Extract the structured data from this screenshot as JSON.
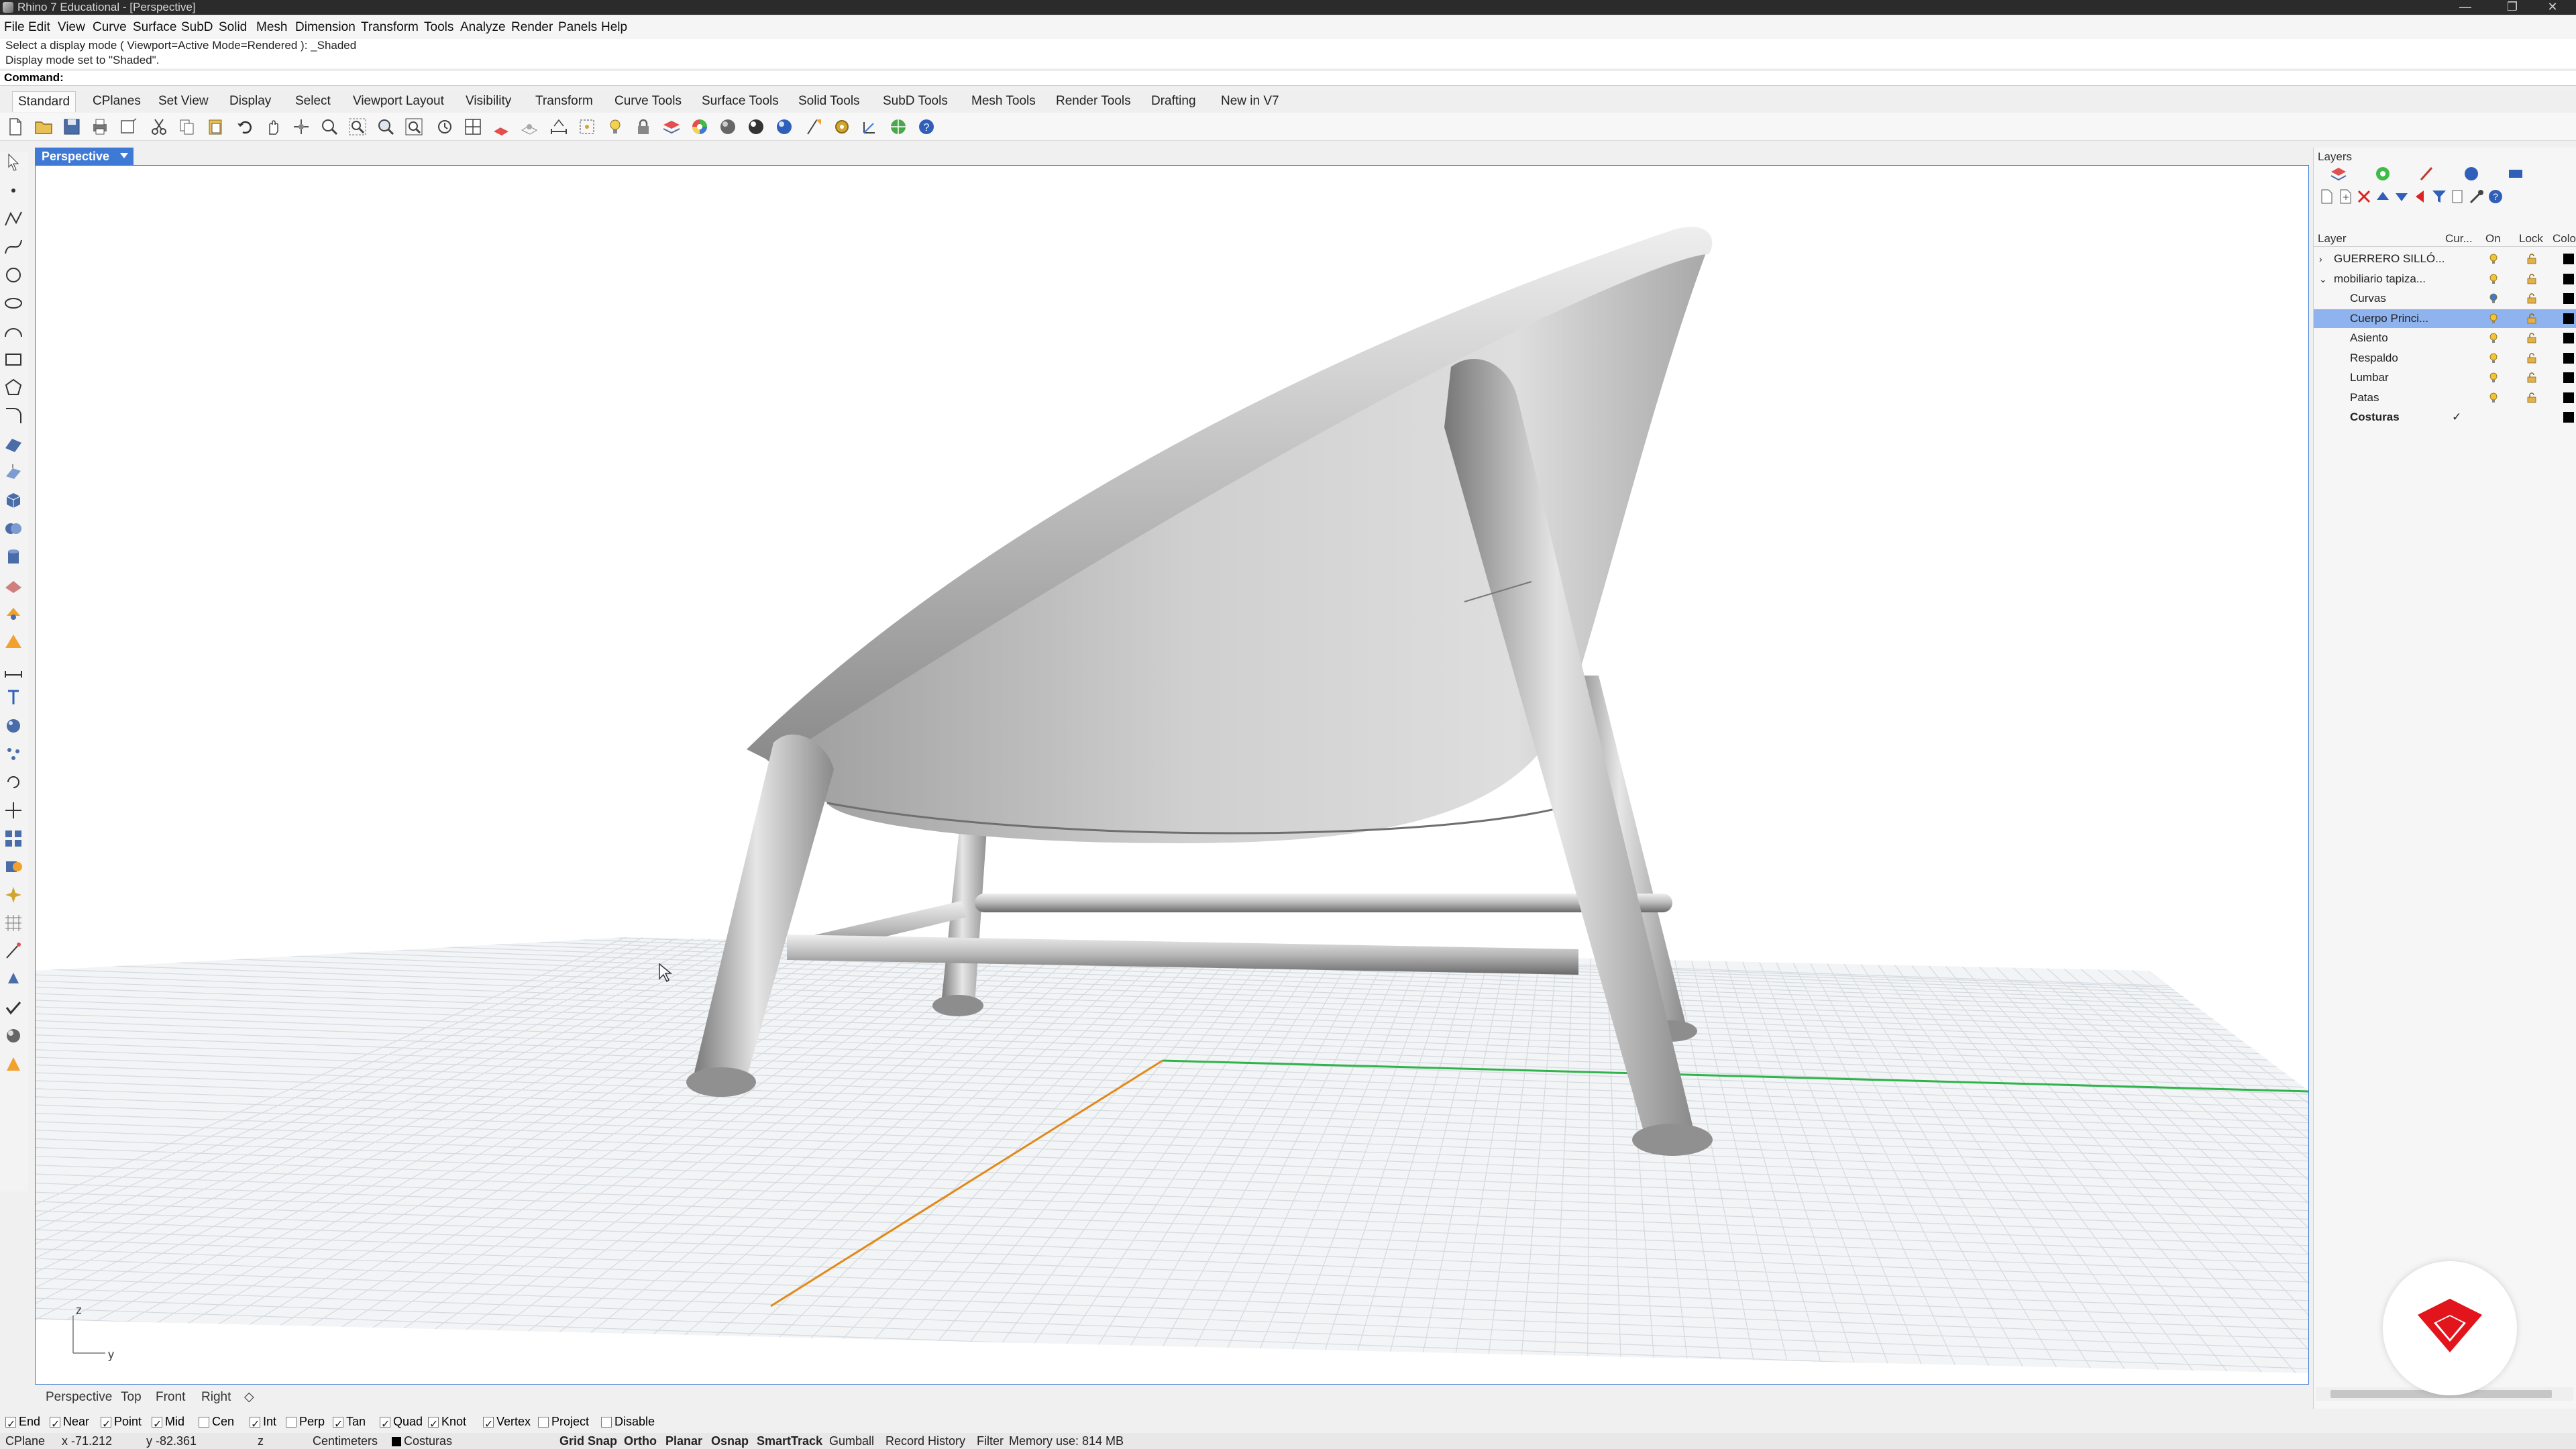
{
  "window": {
    "title": "Rhino 7 Educational - [Perspective]",
    "controls": [
      "—",
      "❐",
      "✕"
    ]
  },
  "menu": [
    "File",
    "Edit",
    "View",
    "Curve",
    "Surface",
    "SubD",
    "Solid",
    "Mesh",
    "Dimension",
    "Transform",
    "Tools",
    "Analyze",
    "Render",
    "Panels",
    "Help"
  ],
  "command": {
    "history": [
      "Select a display mode ( Viewport=Active  Mode=Rendered ): _Shaded",
      "Display mode set to \"Shaded\"."
    ],
    "prompt": "Command:",
    "value": ""
  },
  "toolbar_tabs": [
    "Standard",
    "CPlanes",
    "Set View",
    "Display",
    "Select",
    "Viewport Layout",
    "Visibility",
    "Transform",
    "Curve Tools",
    "Surface Tools",
    "Solid Tools",
    "SubD Tools",
    "Mesh Tools",
    "Render Tools",
    "Drafting",
    "New in V7"
  ],
  "viewport": {
    "name": "Perspective",
    "axis_z": "z",
    "axis_y": "y"
  },
  "view_tabs": [
    "Perspective",
    "Top",
    "Front",
    "Right",
    "◇"
  ],
  "osnaps": [
    {
      "label": "End",
      "on": true
    },
    {
      "label": "Near",
      "on": true
    },
    {
      "label": "Point",
      "on": true
    },
    {
      "label": "Mid",
      "on": true
    },
    {
      "label": "Cen",
      "on": false
    },
    {
      "label": "Int",
      "on": true
    },
    {
      "label": "Perp",
      "on": false
    },
    {
      "label": "Tan",
      "on": true
    },
    {
      "label": "Quad",
      "on": true
    },
    {
      "label": "Knot",
      "on": true
    },
    {
      "label": "Vertex",
      "on": true
    },
    {
      "label": "Project",
      "on": false
    },
    {
      "label": "Disable",
      "on": false
    }
  ],
  "status": {
    "cplane": "CPlane",
    "x": "x -71.212",
    "y": "y -82.361",
    "z": "z",
    "units": "Centimeters",
    "layer": "Costuras",
    "grid_snap": "Grid Snap",
    "ortho": "Ortho",
    "planar": "Planar",
    "osnap": "Osnap",
    "smarttrack": "SmartTrack",
    "gumball": "Gumball",
    "record_history": "Record History",
    "filter": "Filter",
    "memory": "Memory use: 814 MB"
  },
  "layers_panel": {
    "title": "Layers",
    "headers": {
      "layer": "Layer",
      "current": "Cur...",
      "on": "On",
      "lock": "Lock",
      "color": "Colo"
    },
    "rows": [
      {
        "name": "GUERRERO SILLÓ...",
        "indent": 0,
        "expander": "›",
        "current": false,
        "selected": false,
        "bold": false
      },
      {
        "name": "mobiliario tapiza...",
        "indent": 0,
        "expander": "⌄",
        "current": false,
        "selected": false,
        "bold": false
      },
      {
        "name": "Curvas",
        "indent": 1,
        "expander": "",
        "current": false,
        "selected": false,
        "bold": false
      },
      {
        "name": "Cuerpo Princi...",
        "indent": 1,
        "expander": "",
        "current": false,
        "selected": true,
        "bold": false
      },
      {
        "name": "Asiento",
        "indent": 1,
        "expander": "",
        "current": false,
        "selected": false,
        "bold": false
      },
      {
        "name": "Respaldo",
        "indent": 1,
        "expander": "",
        "current": false,
        "selected": false,
        "bold": false
      },
      {
        "name": "Lumbar",
        "indent": 1,
        "expander": "",
        "current": false,
        "selected": false,
        "bold": false
      },
      {
        "name": "Patas",
        "indent": 1,
        "expander": "",
        "current": false,
        "selected": false,
        "bold": false
      },
      {
        "name": "Costuras",
        "indent": 1,
        "expander": "",
        "current": true,
        "selected": false,
        "bold": true
      }
    ]
  },
  "colors": {
    "accent": "#3f79d6",
    "selected_row": "#8fb3ef",
    "x_axis": "#e08a1a",
    "y_axis": "#2fb34a",
    "logo": "#e2141c"
  }
}
